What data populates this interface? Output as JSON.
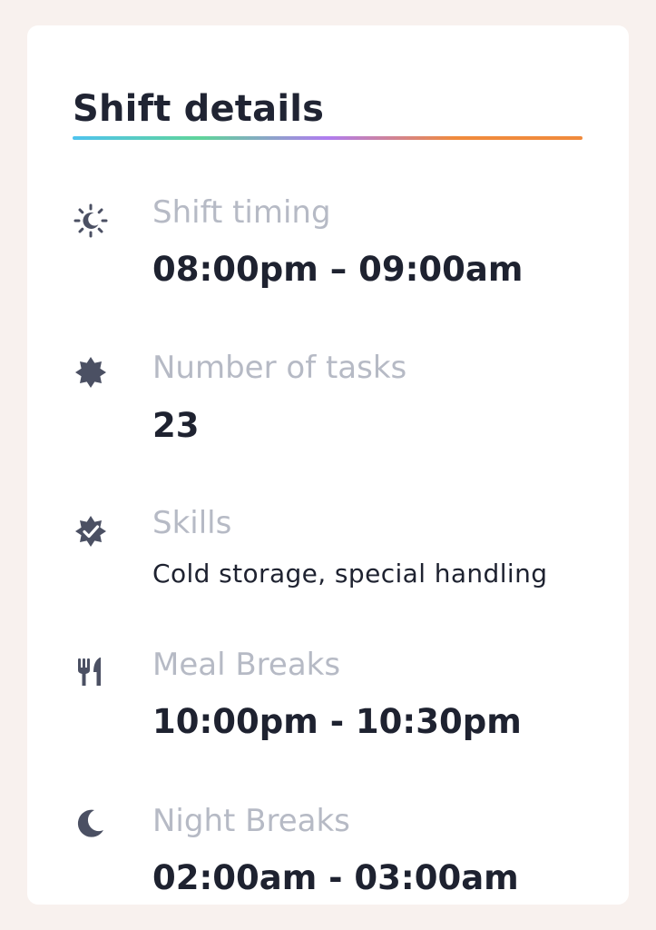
{
  "title": "Shift details",
  "divider_colors": [
    "#4fc3ee",
    "#5fd49a",
    "#b07cf0",
    "#f08a3c"
  ],
  "rows": [
    {
      "icon": "sun-moon-icon",
      "label": "Shift timing",
      "value": "08:00pm – 09:00am"
    },
    {
      "icon": "badge-icon",
      "label": "Number of tasks",
      "value": "23"
    },
    {
      "icon": "verified-badge-icon",
      "label": "Skills",
      "value": "Cold storage, special handling"
    },
    {
      "icon": "fork-knife-icon",
      "label": "Meal Breaks",
      "value": "10:00pm - 10:30pm"
    },
    {
      "icon": "moon-icon",
      "label": "Night Breaks",
      "value": "02:00am - 03:00am"
    }
  ]
}
